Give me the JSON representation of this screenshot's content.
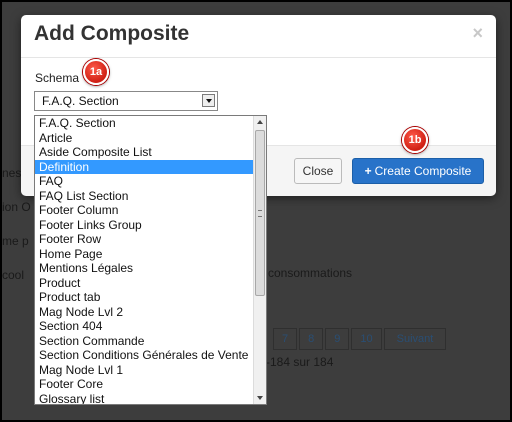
{
  "background": {
    "fragments": [
      "nes",
      "ion O",
      "me p",
      "cool",
      "consommations"
    ],
    "pager_pages": [
      "7",
      "8",
      "9",
      "10"
    ],
    "pager_next": "Suivant",
    "pager_info": "-184 sur 184"
  },
  "modal": {
    "title": "Add Composite",
    "close_symbol": "×",
    "schema_label": "Schema",
    "schema_value": "F.A.Q. Section",
    "close_button": "Close",
    "create_button": "Create Composite",
    "create_icon": "+"
  },
  "dropdown": {
    "selected": "Definition",
    "options": [
      "F.A.Q. Section",
      "Article",
      "Aside Composite List",
      "Definition",
      "FAQ",
      "FAQ List Section",
      "Footer Column",
      "Footer Links Group",
      "Footer Row",
      "Home Page",
      "Mentions Légales",
      "Product",
      "Product tab",
      "Mag Node Lvl 2",
      "Section 404",
      "Section Commande",
      "Section Conditions Générales de Vente",
      "Mag Node Lvl 1",
      "Footer Core",
      "Glossary list"
    ]
  },
  "annotations": {
    "badge_1a": "1a",
    "badge_1b": "1b"
  },
  "colors": {
    "primary": "#2873c9",
    "selected": "#3399ff",
    "badge": "#cf1f14"
  }
}
